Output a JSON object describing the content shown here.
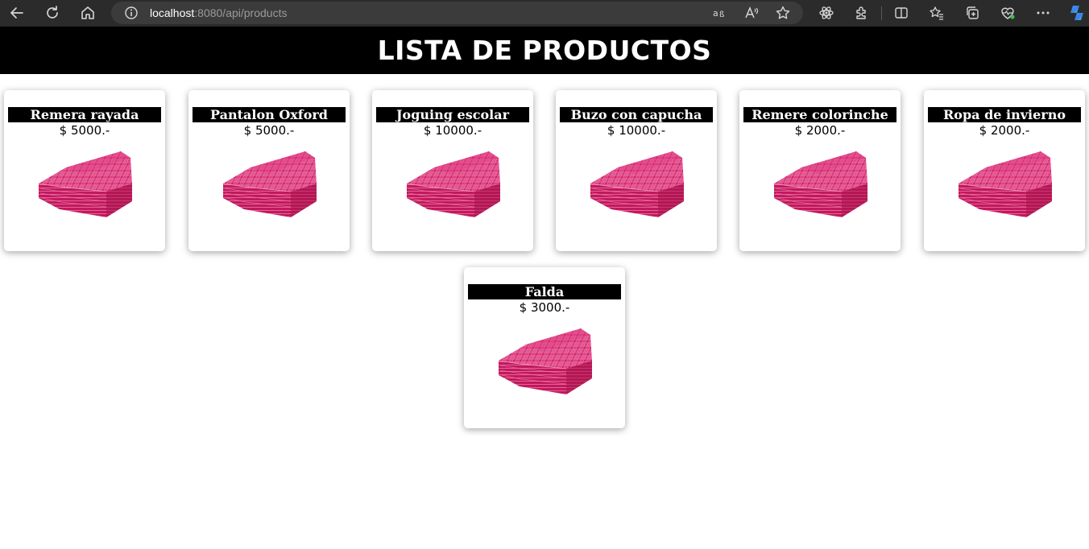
{
  "browser": {
    "url_host": "localhost",
    "url_path": ":8080/api/products",
    "icons": {
      "back": "back-arrow-icon",
      "reload": "reload-icon",
      "home": "home-icon",
      "site_info": "info-icon",
      "translate": "translate-icon",
      "read_aloud": "read-aloud-icon",
      "favorite": "star-icon",
      "extension_1": "atom-icon",
      "extensions": "puzzle-icon",
      "split_screen": "split-screen-icon",
      "favorites_bar": "favorites-icon",
      "collections": "collections-icon",
      "health": "heart-icon",
      "more": "more-dots-icon",
      "copilot": "copilot-icon"
    }
  },
  "page": {
    "title": "LISTA DE PRODUCTOS",
    "colors": {
      "header_bg": "#000000",
      "header_text": "#ffffff",
      "product_image": "#d6246e"
    }
  },
  "products": [
    {
      "name": "Remera rayada",
      "price": "$ 5000.-",
      "image": "pink-folded-towels"
    },
    {
      "name": "Pantalon Oxford",
      "price": "$ 5000.-",
      "image": "pink-folded-towels"
    },
    {
      "name": "Joguing escolar",
      "price": "$ 10000.-",
      "image": "pink-folded-towels"
    },
    {
      "name": "Buzo con capucha",
      "price": "$ 10000.-",
      "image": "pink-folded-towels"
    },
    {
      "name": "Remere colorinche",
      "price": "$ 2000.-",
      "image": "pink-folded-towels"
    },
    {
      "name": "Ropa de invierno",
      "price": "$ 2000.-",
      "image": "pink-folded-towels"
    },
    {
      "name": "Falda",
      "price": "$ 3000.-",
      "image": "pink-folded-towels"
    }
  ]
}
